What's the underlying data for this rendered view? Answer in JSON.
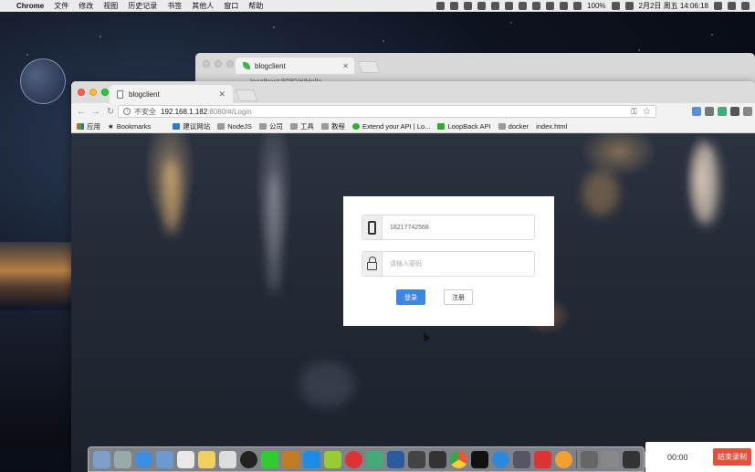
{
  "menubar": {
    "app": "Chrome",
    "items": [
      "文件",
      "修改",
      "视图",
      "历史记录",
      "书签",
      "其他人",
      "窗口",
      "帮助"
    ],
    "battery": "100%",
    "datetime": "2月2日 周五  14:06:18"
  },
  "back_window": {
    "tab_title": "blogclient",
    "url": "localhost:8080/#/Hello"
  },
  "window": {
    "tab_title": "blogclient",
    "omnibox": {
      "security_label": "不安全",
      "host": "192.168.1.182",
      "path": ":8080/#/Login"
    },
    "bookmarks": [
      "应用",
      "Bookmarks",
      "",
      "",
      "建议网站",
      "NodeJS",
      "公司",
      "工具",
      "教程",
      "Extend your API | Lo...",
      "LoopBack API",
      "docker",
      "index.html"
    ]
  },
  "login": {
    "phone_value": "18217742568",
    "password_placeholder": "请输入密码",
    "login_button": "登录",
    "register_button": "注册"
  },
  "recorder": {
    "time": "00:00",
    "stop_label": "结束录制"
  },
  "colors": {
    "primary_button": "#3d86e6",
    "record_button": "#e4503c"
  }
}
